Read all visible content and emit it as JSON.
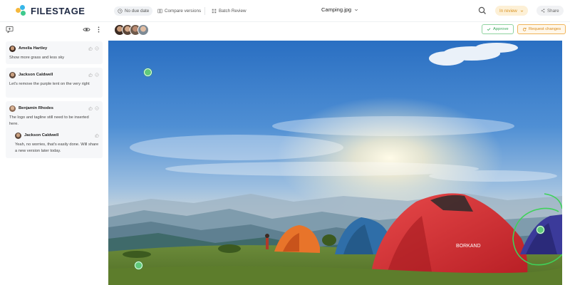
{
  "app": {
    "logo_text": "FILESTAGE"
  },
  "header": {
    "due_date": "No due date",
    "compare": "Compare versions",
    "batch": "Batch Review",
    "file_name": "Camping.jpg",
    "status": "In review",
    "share": "Share"
  },
  "actions": {
    "approve": "Approve",
    "request_changes": "Request changes"
  },
  "comments": [
    {
      "author": "Amelia Hartley",
      "text": "Show more grass and less sky",
      "avatar_color": "#4a3b32"
    },
    {
      "author": "Jackson Caldwell",
      "text": "Let's remove the purple tent on the very right",
      "avatar_color": "#6b5a4f"
    },
    {
      "author": "Benjamin Rhodes",
      "text": "The logo and tagline still need to be inserted here.",
      "avatar_color": "#8a6a55",
      "reply": {
        "author": "Jackson Caldwell",
        "text": "Yeah, no worries, that's easily done. Will share a new version later today.",
        "avatar_color": "#6b5a4f"
      }
    }
  ],
  "colors": {
    "accent_green": "#5fc97a",
    "status_orange": "#d99323",
    "brand_navy": "#1f2a44"
  }
}
